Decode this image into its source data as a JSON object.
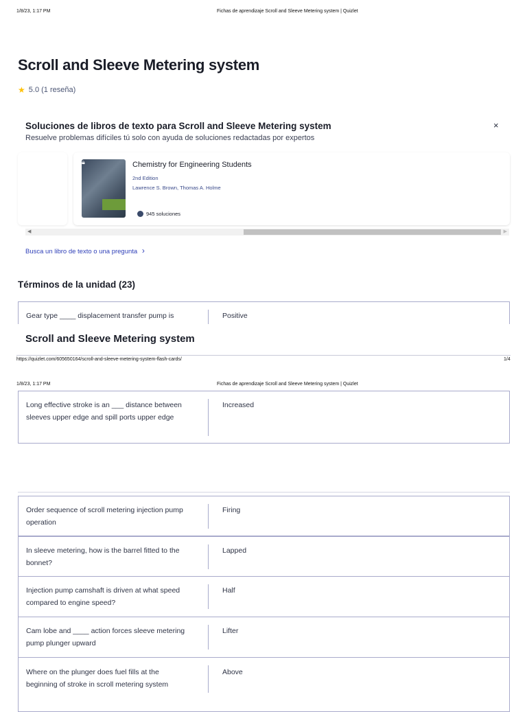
{
  "print_header": {
    "datetime": "1/8/23, 1:17 PM",
    "page_title": "Fichas de aprendizaje Scroll and Sleeve Metering system | Quizlet"
  },
  "print_footer": {
    "url": "https://quizlet.com/605650164/scroll-and-sleeve-metering-system-flash-cards/",
    "page": "1/4"
  },
  "title": "Scroll and Sleeve Metering system",
  "rating": {
    "icon": "star-icon",
    "text": "5.0 (1 reseña)",
    "color": "#ffc107"
  },
  "solutions": {
    "title": "Soluciones de libros de texto para Scroll and Sleeve Metering system",
    "subtitle": "Resuelve problemas difíciles tú solo con ayuda de soluciones redactadas por expertos",
    "close": "×",
    "book": {
      "title": "Chemistry for Engineering Students",
      "edition": "2nd Edition",
      "authors": "Lawrence S. Brown, Thomas A. Holme",
      "solutions": "945 soluciones"
    },
    "search_link": "Busca un libro de texto o una pregunta"
  },
  "terms_heading": "Términos de la unidad (23)",
  "overlay_title": "Scroll and Sleeve Metering system",
  "terms": [
    {
      "term": "Gear type ____ displacement transfer pump is",
      "definition": "Positive"
    },
    {
      "term": "Long effective stroke is an ___ distance between sleeves upper edge and spill ports upper edge",
      "definition": "Increased"
    },
    {
      "term": "Order sequence of scroll metering injection pump operation",
      "definition": "Firing"
    },
    {
      "term": "In sleeve metering, how is the barrel fitted to the bonnet?",
      "definition": "Lapped"
    },
    {
      "term": "Injection pump camshaft is driven at what speed compared to engine speed?",
      "definition": "Half"
    },
    {
      "term": "Cam lobe and ____ action forces sleeve metering pump plunger upward",
      "definition": "Lifter"
    },
    {
      "term": "Where on the plunger does fuel fills at the beginning of stroke in scroll metering system",
      "definition": "Above"
    }
  ]
}
